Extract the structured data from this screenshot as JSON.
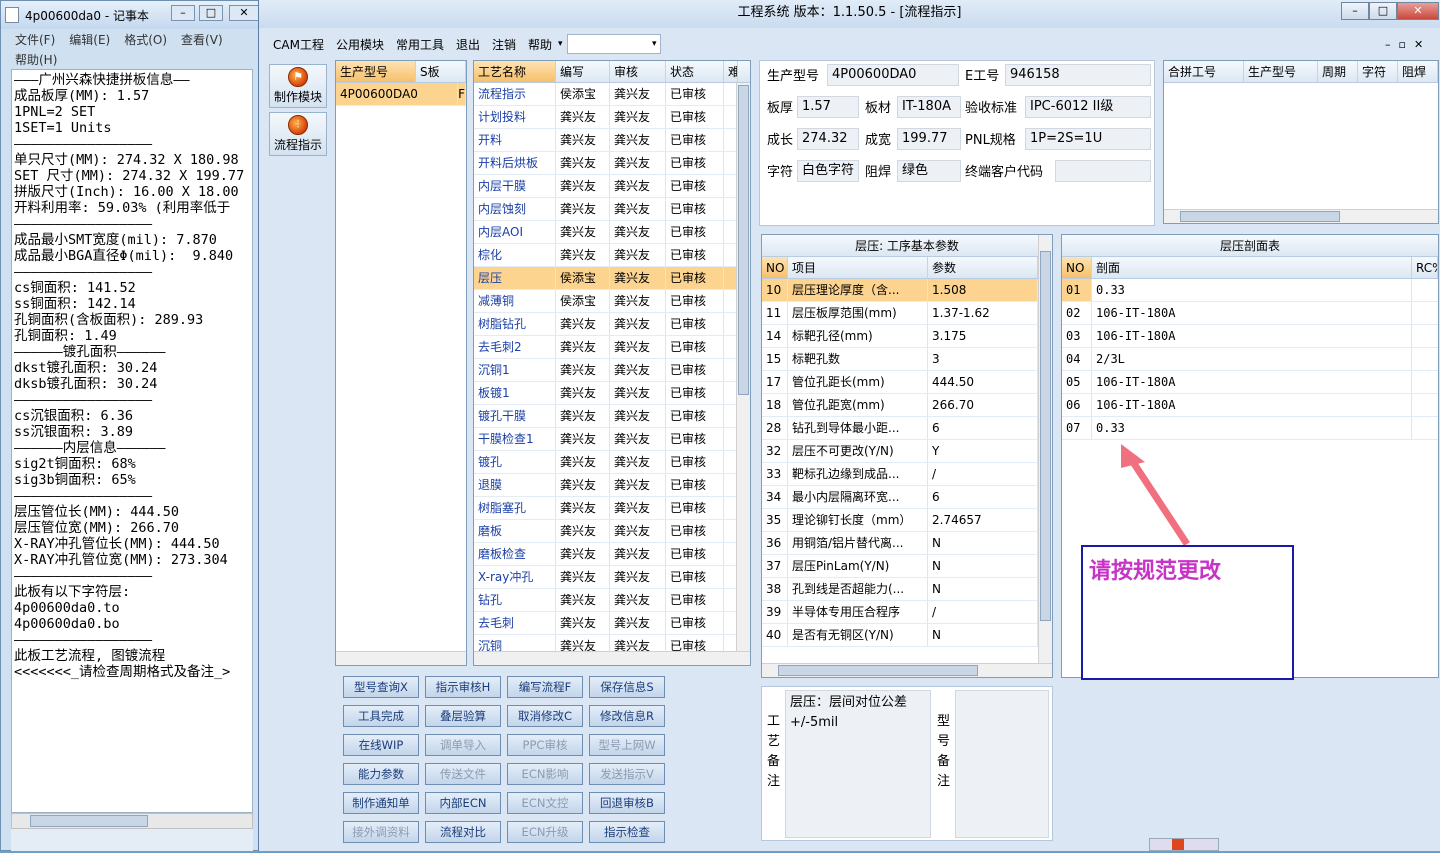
{
  "notepad": {
    "title": "4p00600da0 - 记事本",
    "menu": [
      "文件(F)",
      "编辑(E)",
      "格式(O)",
      "查看(V)"
    ],
    "menu2": "帮助(H)",
    "lines": [
      "———广州兴森快捷拼板信息——",
      "成品板厚(MM): 1.57",
      "1PNL=2 SET",
      "1SET=1 Units",
      "—————————————————",
      "单只尺寸(MM): 274.32 X 180.98",
      "SET 尺寸(MM): 274.32 X 199.77",
      "拼版尺寸(Inch): 16.00 X 18.00",
      "开料利用率: 59.03% (利用率低于",
      "—————————————————",
      "成品最小SMT宽度(mil): 7.870",
      "成品最小BGA直径Φ(mil):  9.840",
      "—————————————————",
      "cs铜面积: 141.52",
      "ss铜面积: 142.14",
      "孔铜面积(含板面积): 289.93",
      "孔铜面积: 1.49",
      "——————镀孔面积——————",
      "dkst镀孔面积: 30.24",
      "dksb镀孔面积: 30.24",
      "",
      "—————————————————",
      "cs沉银面积: 6.36",
      "ss沉银面积: 3.89",
      "——————内层信息——————",
      "sig2t铜面积: 68%",
      "sig3b铜面积: 65%",
      "—————————————————",
      "层压管位长(MM): 444.50",
      "层压管位宽(MM): 266.70",
      "X-RAY冲孔管位长(MM): 444.50",
      "X-RAY冲孔管位宽(MM): 273.304",
      "—————————————————",
      "此板有以下字符层:",
      "4p00600da0.to",
      "4p00600da0.bo",
      "—————————————————",
      "此板工艺流程, 图镀流程",
      "<<<<<<<_请检查周期格式及备注_>"
    ]
  },
  "app": {
    "title": "工程系统   版本：1.1.50.5 - [流程指示]",
    "menu": [
      "CAM工程",
      "公用模块",
      "常用工具",
      "退出",
      "注销",
      "帮助"
    ],
    "side": [
      {
        "label": "制作模块"
      },
      {
        "label": "流程指示"
      }
    ],
    "model_grid": {
      "headers": [
        "生产型号",
        "S板"
      ],
      "rows": [
        [
          "4P00600DA0",
          "F"
        ]
      ]
    },
    "process_grid": {
      "headers": [
        "工艺名称",
        "编写",
        "审核",
        "状态",
        "难"
      ],
      "rows": [
        [
          "流程指示",
          "侯添宝",
          "龚兴友",
          "已审核"
        ],
        [
          "计划投料",
          "龚兴友",
          "龚兴友",
          "已审核"
        ],
        [
          "开料",
          "龚兴友",
          "龚兴友",
          "已审核"
        ],
        [
          "开料后烘板",
          "龚兴友",
          "龚兴友",
          "已审核"
        ],
        [
          "内层干膜",
          "龚兴友",
          "龚兴友",
          "已审核"
        ],
        [
          "内层蚀刻",
          "龚兴友",
          "龚兴友",
          "已审核"
        ],
        [
          "内层AOI",
          "龚兴友",
          "龚兴友",
          "已审核"
        ],
        [
          "棕化",
          "龚兴友",
          "龚兴友",
          "已审核"
        ],
        [
          "层压",
          "侯添宝",
          "龚兴友",
          "已审核"
        ],
        [
          "减薄铜",
          "侯添宝",
          "龚兴友",
          "已审核"
        ],
        [
          "树脂钻孔",
          "龚兴友",
          "龚兴友",
          "已审核"
        ],
        [
          "去毛刺2",
          "龚兴友",
          "龚兴友",
          "已审核"
        ],
        [
          "沉铜1",
          "龚兴友",
          "龚兴友",
          "已审核"
        ],
        [
          "板镀1",
          "龚兴友",
          "龚兴友",
          "已审核"
        ],
        [
          "镀孔干膜",
          "龚兴友",
          "龚兴友",
          "已审核"
        ],
        [
          "干膜检查1",
          "龚兴友",
          "龚兴友",
          "已审核"
        ],
        [
          "镀孔",
          "龚兴友",
          "龚兴友",
          "已审核"
        ],
        [
          "退膜",
          "龚兴友",
          "龚兴友",
          "已审核"
        ],
        [
          "树脂塞孔",
          "龚兴友",
          "龚兴友",
          "已审核"
        ],
        [
          "磨板",
          "龚兴友",
          "龚兴友",
          "已审核"
        ],
        [
          "磨板检查",
          "龚兴友",
          "龚兴友",
          "已审核"
        ],
        [
          "X-ray冲孔",
          "龚兴友",
          "龚兴友",
          "已审核"
        ],
        [
          "钻孔",
          "龚兴友",
          "龚兴友",
          "已审核"
        ],
        [
          "去毛刺",
          "龚兴友",
          "龚兴友",
          "已审核"
        ],
        [
          "沉铜",
          "龚兴友",
          "龚兴友",
          "已审核"
        ]
      ],
      "selected_index": 8
    },
    "buttons": [
      [
        "型号查询X",
        "指示审核H",
        "编写流程F",
        "保存信息S"
      ],
      [
        "工具完成",
        "叠层验算",
        "取消修改C",
        "修改信息R"
      ],
      [
        "在线WIP",
        "调单导入",
        "PPC审核",
        "型号上网W"
      ],
      [
        "能力参数",
        "传送文件",
        "ECN影响",
        "发送指示V"
      ],
      [
        "制作通知单",
        "内部ECN",
        "ECN文控",
        "回退审核B"
      ],
      [
        "接外调资料",
        "流程对比",
        "ECN升级",
        "指示检查"
      ]
    ],
    "info": {
      "prod_model_label": "生产型号",
      "prod_model": "4P00600DA0",
      "e_no_label": "E工号",
      "e_no": "946158",
      "thick_label": "板厚",
      "thick": "1.57",
      "material_label": "板材",
      "material": "IT-180A",
      "accept_label": "验收标准",
      "accept": "IPC-6012 II级",
      "len_label": "成长",
      "len": "274.32",
      "wid_label": "成宽",
      "wid": "199.77",
      "pnl_label": "PNL规格",
      "pnl": "1P=2S=1U",
      "char_label": "字符",
      "char": "白色字符",
      "mask_label": "阻焊",
      "mask": "绿色",
      "cust_label": "终端客户代码",
      "cust": ""
    },
    "merge_grid": {
      "headers": [
        "合拼工号",
        "生产型号",
        "周期",
        "字符",
        "阻焊"
      ]
    },
    "param": {
      "title": "层压: 工序基本参数",
      "headers": [
        "NO",
        "项目",
        "参数"
      ],
      "rows": [
        [
          "10",
          "层压理论厚度（含...",
          "1.508"
        ],
        [
          "11",
          "层压板厚范围(mm)",
          "1.37-1.62"
        ],
        [
          "14",
          "标靶孔径(mm)",
          "3.175"
        ],
        [
          "15",
          "标靶孔数",
          "3"
        ],
        [
          "17",
          "管位孔距长(mm)",
          "444.50"
        ],
        [
          "18",
          "管位孔距宽(mm)",
          "266.70"
        ],
        [
          "28",
          "钻孔到导体最小距...",
          "6"
        ],
        [
          "32",
          "层压不可更改(Y/N)",
          "Y"
        ],
        [
          "33",
          "靶标孔边缘到成品...",
          "/"
        ],
        [
          "34",
          "最小内层隔离环宽...",
          "6"
        ],
        [
          "35",
          "理论铆钉长度（mm）",
          "2.74657"
        ],
        [
          "36",
          "用铜箔/铝片替代离...",
          "N"
        ],
        [
          "37",
          "层压PinLam(Y/N)",
          "N"
        ],
        [
          "38",
          "孔到线是否超能力(...",
          "N"
        ],
        [
          "39",
          "半导体专用压合程序",
          "/"
        ],
        [
          "40",
          "是否有无铜区(Y/N)",
          "N"
        ]
      ]
    },
    "section": {
      "title": "层压剖面表",
      "headers": [
        "NO",
        "剖面",
        "RC%"
      ],
      "rows": [
        [
          "01",
          "0.33"
        ],
        [
          "02",
          "106-IT-180A"
        ],
        [
          "03",
          "106-IT-180A"
        ],
        [
          "04",
          "2/3L"
        ],
        [
          "05",
          "106-IT-180A"
        ],
        [
          "06",
          "106-IT-180A"
        ],
        [
          "07",
          "0.33"
        ]
      ]
    },
    "remark": {
      "process_label": "工艺备注",
      "process_text": "层压：层间对位公差+/-5mil",
      "model_label": "型号备注"
    },
    "annotation": {
      "text": "请按规范更改",
      "color": "#c733c7"
    }
  }
}
